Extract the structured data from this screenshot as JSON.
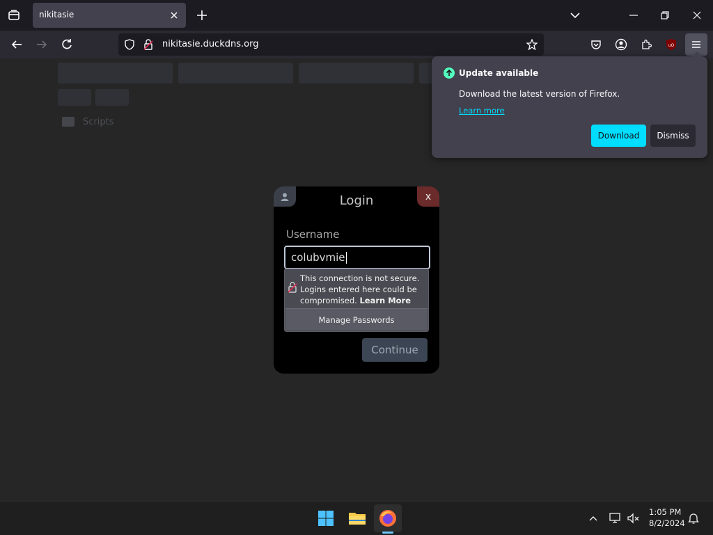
{
  "browser": {
    "tab_title": "nikitasie",
    "url": "nikitasie.duckdns.org"
  },
  "background": {
    "folder_label": "Scripts"
  },
  "login": {
    "title": "Login",
    "close_label": "x",
    "username_label": "Username",
    "username_value": "colubvmie",
    "continue_label": "Continue"
  },
  "insecure": {
    "message": "This connection is not secure. Logins entered here could be compromised.",
    "learn_more": "Learn More",
    "manage_passwords": "Manage Passwords"
  },
  "update": {
    "title": "Update available",
    "description": "Download the latest version of Firefox.",
    "learn_more": "Learn more",
    "download_label": "Download",
    "dismiss_label": "Dismiss"
  },
  "taskbar": {
    "time": "1:05 PM",
    "date": "8/2/2024"
  },
  "colors": {
    "accent": "#00ddff",
    "modal_close": "#6b2b2b",
    "continue_button": "#3b4554"
  }
}
